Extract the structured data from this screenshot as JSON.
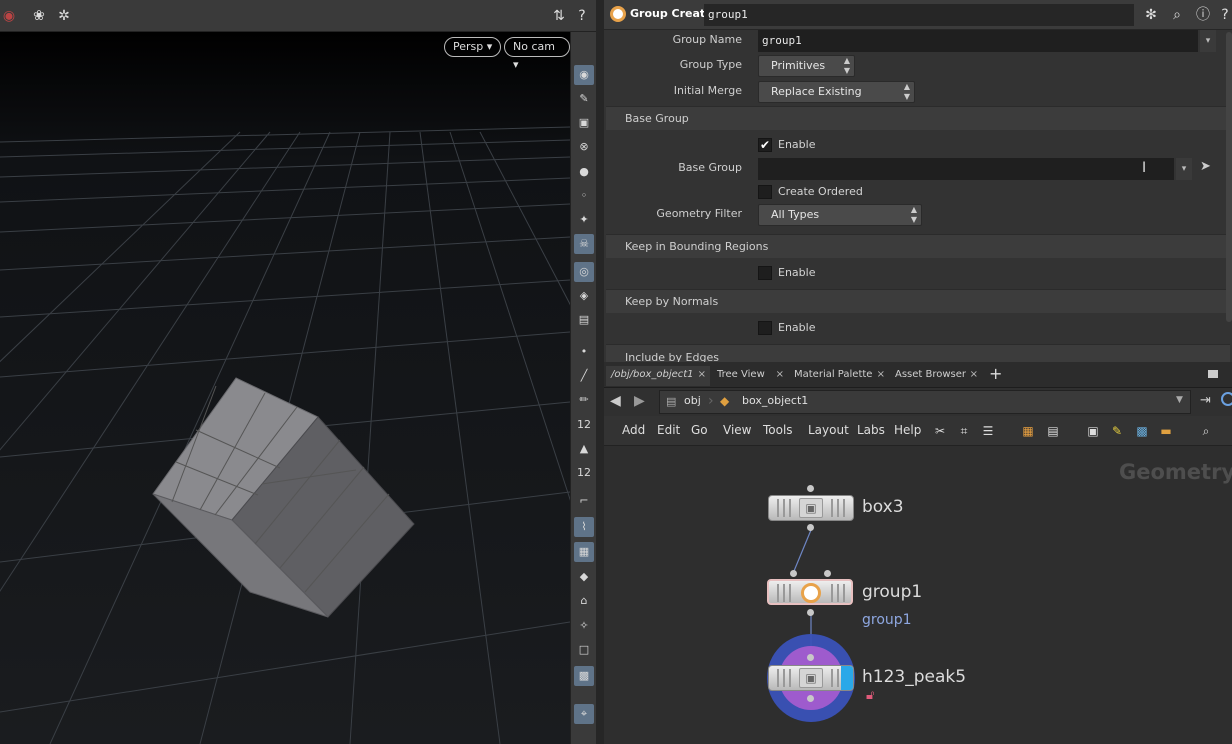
{
  "viewport": {
    "view_menu": "Persp",
    "cam_menu": "No cam"
  },
  "params": {
    "node_type": "Group Create",
    "node_name": "group1",
    "group_name_label": "Group Name",
    "group_name_value": "group1",
    "group_type_label": "Group Type",
    "group_type_value": "Primitives",
    "initial_merge_label": "Initial Merge",
    "initial_merge_value": "Replace Existing",
    "base_group_folder": "Base Group",
    "enable_label": "Enable",
    "base_group_label": "Base Group",
    "create_ordered_label": "Create Ordered",
    "geometry_filter_label": "Geometry Filter",
    "geometry_filter_value": "All Types",
    "keep_bounding_folder": "Keep in Bounding Regions",
    "keep_normals_folder": "Keep by Normals",
    "include_edges_folder": "Include by Edges"
  },
  "network": {
    "tabs": [
      "/obj/box_object1",
      "Tree View",
      "Material Palette",
      "Asset Browser"
    ],
    "crumbs": [
      "obj",
      "box_object1"
    ],
    "menu": [
      "Add",
      "Edit",
      "Go",
      "View",
      "Tools",
      "Layout",
      "Labs",
      "Help"
    ],
    "watermark": "Geometry",
    "nodes": {
      "box3": "box3",
      "group1": "group1",
      "group1_sub": "group1",
      "peak": "h123_peak5"
    }
  }
}
